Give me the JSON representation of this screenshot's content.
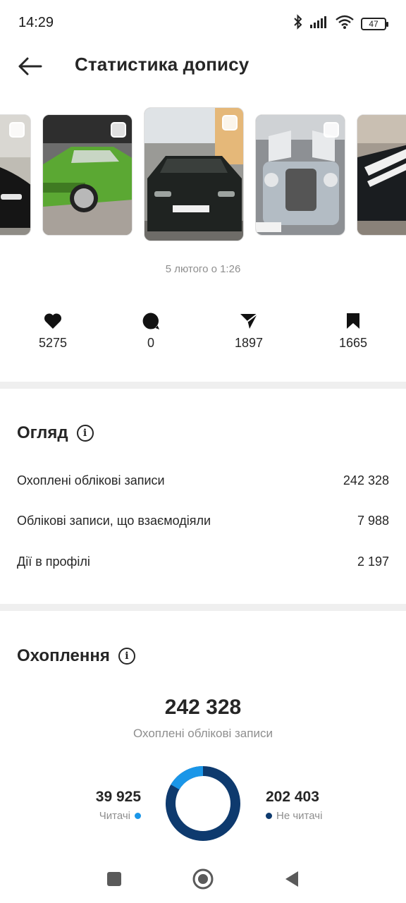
{
  "status": {
    "time": "14:29",
    "battery": "47"
  },
  "header": {
    "title": "Статистика допису"
  },
  "post": {
    "date": "5 лютого о 1:26"
  },
  "metrics": [
    {
      "icon": "heart-icon",
      "value": "5275"
    },
    {
      "icon": "comment-icon",
      "value": "0"
    },
    {
      "icon": "share-icon",
      "value": "1897"
    },
    {
      "icon": "bookmark-icon",
      "value": "1665"
    }
  ],
  "overview": {
    "title": "Огляд",
    "rows": [
      {
        "label": "Охоплені облікові записи",
        "value": "242 328"
      },
      {
        "label": "Облікові записи, що взаємодіяли",
        "value": "7 988"
      },
      {
        "label": "Дії в профілі",
        "value": "2 197"
      }
    ]
  },
  "reach": {
    "title": "Охоплення",
    "total": "242 328",
    "subtitle": "Охоплені облікові записи",
    "followers": {
      "value": "39 925",
      "label": "Читачі",
      "color": "#1a96e8",
      "fraction": 0.1648
    },
    "non_followers": {
      "value": "202 403",
      "label": "Не читачі",
      "color": "#0e3a6e",
      "fraction": 0.8352
    }
  },
  "colors": {
    "accent": "#1a96e8",
    "dark": "#0e3a6e"
  }
}
